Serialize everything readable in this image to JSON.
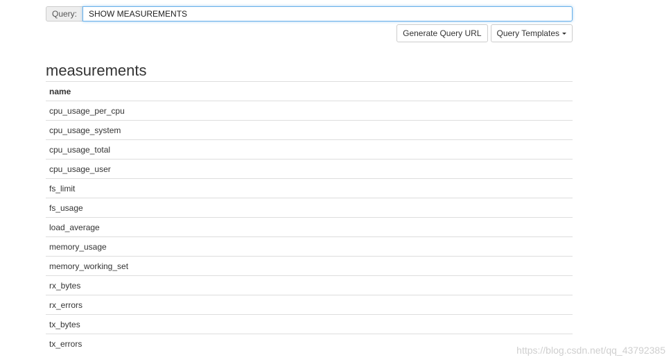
{
  "query": {
    "label": "Query:",
    "value": "SHOW MEASUREMENTS"
  },
  "buttons": {
    "generate_url": "Generate Query URL",
    "templates": "Query Templates"
  },
  "results": {
    "title": "measurements",
    "column": "name",
    "rows": [
      "cpu_usage_per_cpu",
      "cpu_usage_system",
      "cpu_usage_total",
      "cpu_usage_user",
      "fs_limit",
      "fs_usage",
      "load_average",
      "memory_usage",
      "memory_working_set",
      "rx_bytes",
      "rx_errors",
      "tx_bytes",
      "tx_errors"
    ]
  },
  "watermark": "https://blog.csdn.net/qq_43792385"
}
